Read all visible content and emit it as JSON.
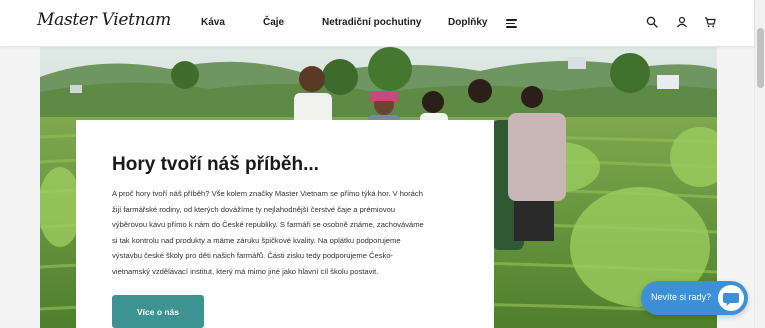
{
  "header": {
    "logo": "Master Vietnam",
    "nav": [
      {
        "label": "Káva"
      },
      {
        "label": "Čaje"
      },
      {
        "label": "Netradiční pochutiny"
      },
      {
        "label": "Doplňky"
      }
    ],
    "icons": [
      "menu-icon",
      "search-icon",
      "user-icon",
      "cart-icon"
    ]
  },
  "hero": {
    "title": "Hory tvoří náš příběh...",
    "lines": [
      "A proč hory tvoří náš příběh? Vše kolem značky Master Vietnam se přímo týká hor. V horách",
      "žijí farmářské rodiny, od kterých dovážíme ty nejlahodnější čerstvé čaje a prémiovou",
      "výběrovou kávu přímo k nám do České republiky. S farmáři se osobně známe, zachováváme",
      "si tak kontrolu nad produkty a máme záruku špičkové kvality. Na oplátku podporujeme",
      "výstavbu české školy pro děti našich farmářů. Části zisku tedy podporujeme Česko-",
      "vietnamský vzdělávací institut, který má mimo jiné jako hlavní cíl školu postavit."
    ],
    "button": "Více o nás"
  },
  "chat": {
    "label": "Nevíte si rady?",
    "icon": "chat-bubble-icon"
  },
  "colors": {
    "accent": "#3c9391",
    "chat": "#3d8fd6",
    "text": "#1a1a1a"
  }
}
